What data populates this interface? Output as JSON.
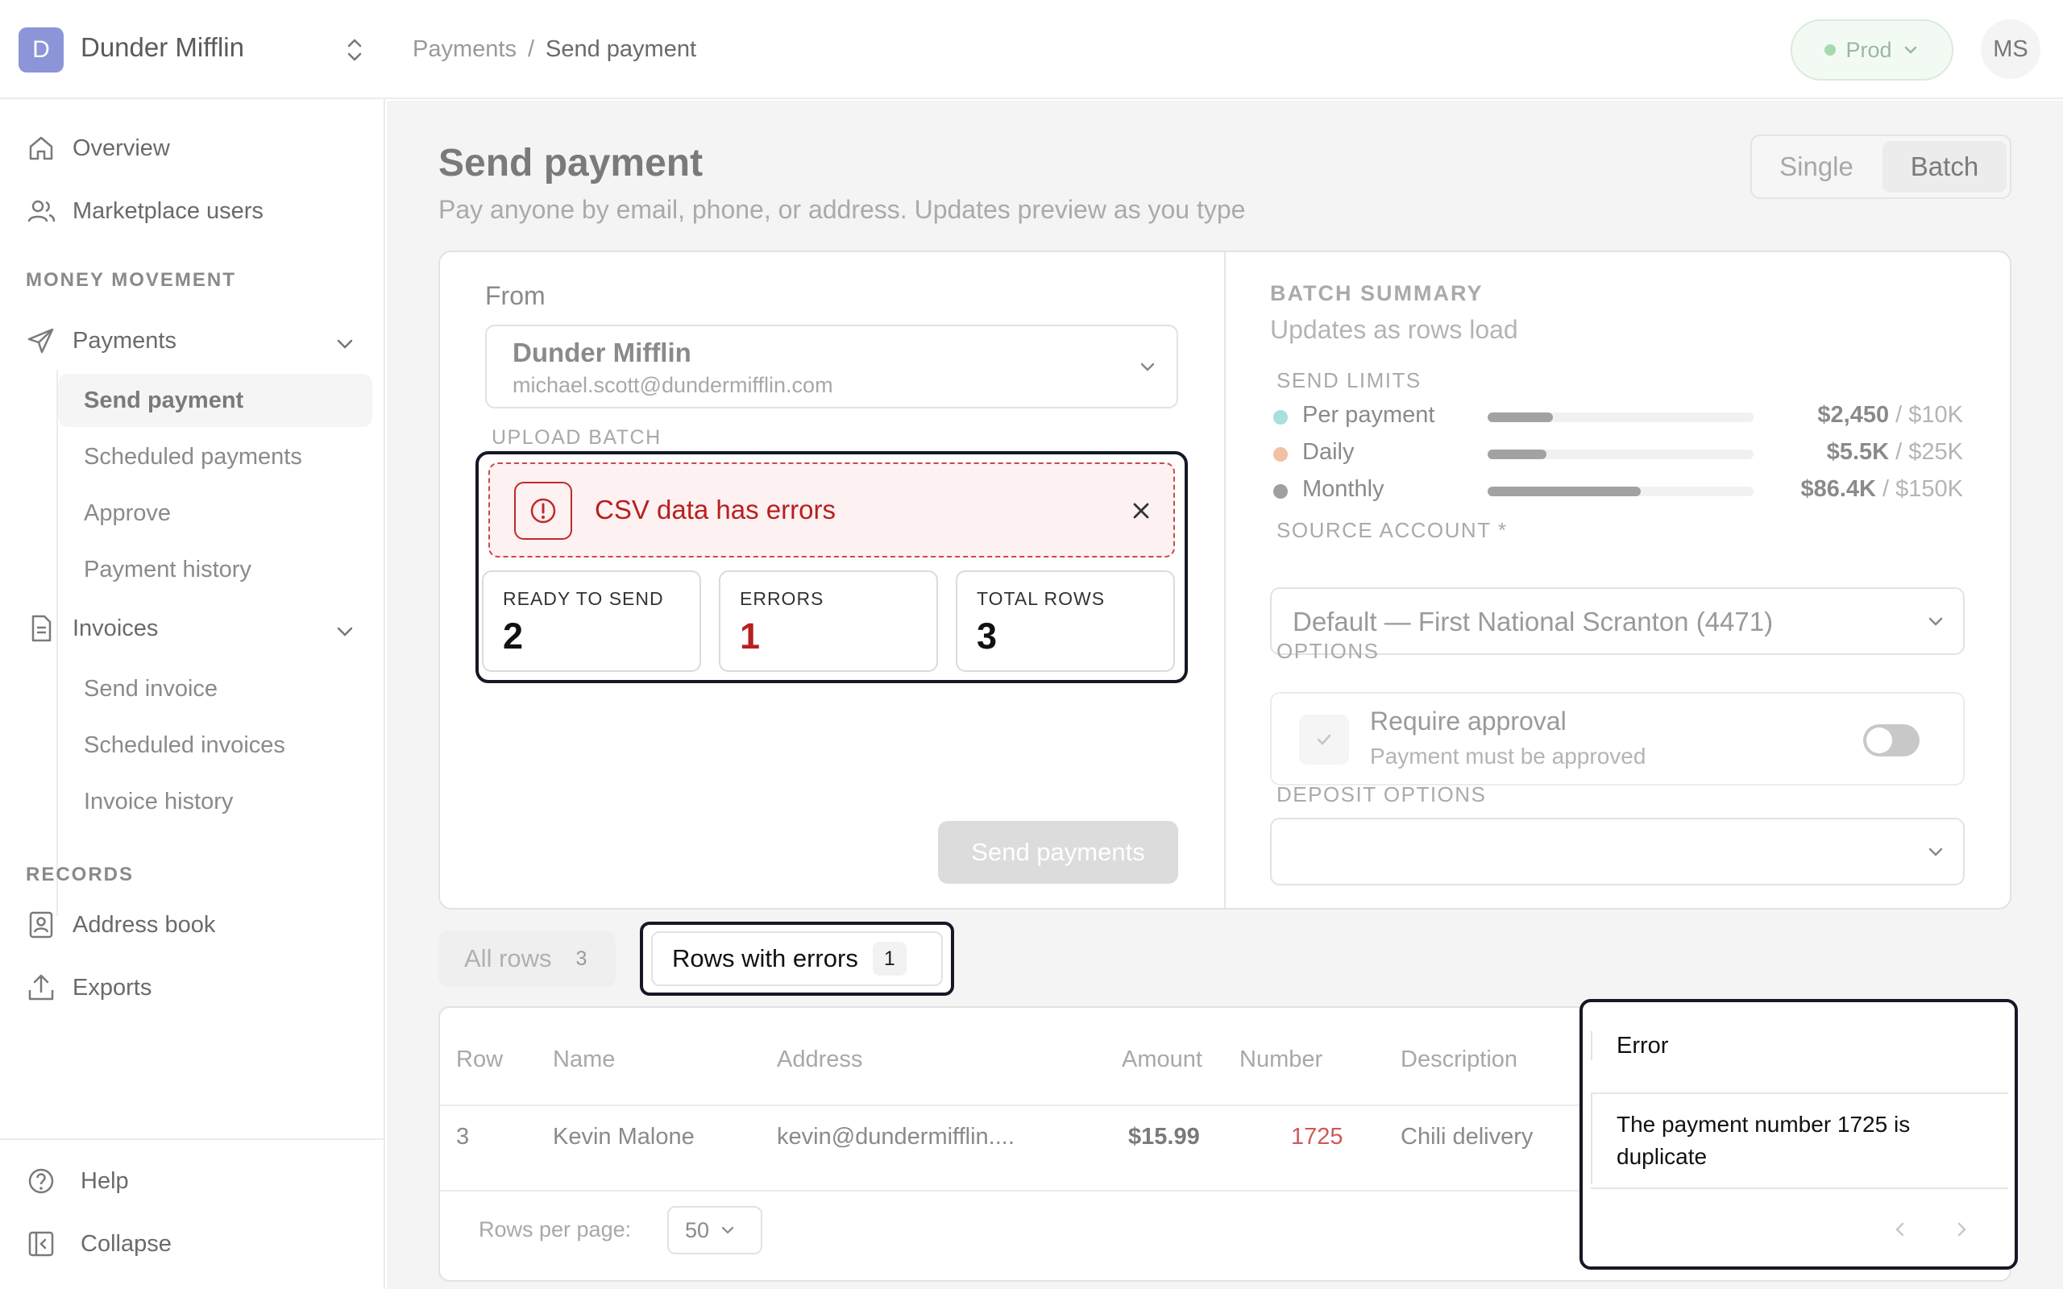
{
  "org": {
    "initial": "D",
    "name": "Dunder Mifflin"
  },
  "breadcrumb": {
    "parent": "Payments",
    "separator": "/",
    "current": "Send payment"
  },
  "env": {
    "label": "Prod"
  },
  "user": {
    "initials": "MS"
  },
  "sidebar": {
    "overview": "Overview",
    "marketplace_users": "Marketplace users",
    "section_money": "MONEY MOVEMENT",
    "payments": "Payments",
    "payments_children": [
      "Send payment",
      "Scheduled payments",
      "Approve",
      "Payment history"
    ],
    "invoices": "Invoices",
    "invoices_children": [
      "Send invoice",
      "Scheduled invoices",
      "Invoice history"
    ],
    "section_records": "RECORDS",
    "address_book": "Address book",
    "exports": "Exports",
    "help": "Help",
    "collapse": "Collapse"
  },
  "page": {
    "title": "Send payment",
    "subtitle": "Pay anyone by email, phone, or address. Updates preview as you type",
    "mode_single": "Single",
    "mode_batch": "Batch",
    "mode_selected": "Batch"
  },
  "from": {
    "label": "From",
    "name": "Dunder Mifflin",
    "email": "michael.scott@dundermifflin.com"
  },
  "upload": {
    "label": "UPLOAD BATCH",
    "error_banner": "CSV data has errors",
    "stats": [
      {
        "label": "READY TO SEND",
        "value": "2"
      },
      {
        "label": "ERRORS",
        "value": "1"
      },
      {
        "label": "TOTAL ROWS",
        "value": "3"
      }
    ]
  },
  "send_button": "Send payments",
  "summary": {
    "title": "BATCH SUMMARY",
    "subtitle": "Updates as rows load",
    "limits_label": "SEND LIMITS",
    "limits": [
      {
        "name": "Per payment",
        "used": "$2,450",
        "max": " / $10K",
        "fraction": 0.245,
        "dot_color": "#a8e0dc"
      },
      {
        "name": "Daily",
        "used": "$5.5K",
        "max": " / $25K",
        "fraction": 0.22,
        "dot_color": "#f2c0a2"
      },
      {
        "name": "Monthly",
        "used": "$86.4K",
        "max": " / $150K",
        "fraction": 0.576,
        "dot_color": "#a0a0a0"
      }
    ],
    "source_label": "SOURCE ACCOUNT *",
    "source_value": "Default — First National Scranton (4471)",
    "options_label": "OPTIONS",
    "approval_title": "Require approval",
    "approval_sub": "Payment must be approved",
    "approval_on": false,
    "deposit_label": "DEPOSIT OPTIONS",
    "deposit_value": ""
  },
  "tabs": {
    "all_label": "All rows",
    "all_count": "3",
    "errors_label": "Rows with errors",
    "errors_count": "1",
    "selected": "Rows with errors"
  },
  "table": {
    "headers": [
      "Row",
      "Name",
      "Address",
      "Amount",
      "Number",
      "Description",
      "Error"
    ],
    "rows": [
      {
        "row": "3",
        "name": "Kevin Malone",
        "address": "kevin@dundermifflin....",
        "amount": "$15.99",
        "number": "1725",
        "description": "Chili delivery",
        "error": "The payment number 1725 is duplicate"
      }
    ],
    "rows_per_page_label": "Rows per page:",
    "rows_per_page": "50"
  },
  "colors": {
    "error_red": "#b81f1f",
    "highlight_frame": "#141826",
    "accent": "#8b95d8",
    "env_green": "#a6d9b0"
  }
}
